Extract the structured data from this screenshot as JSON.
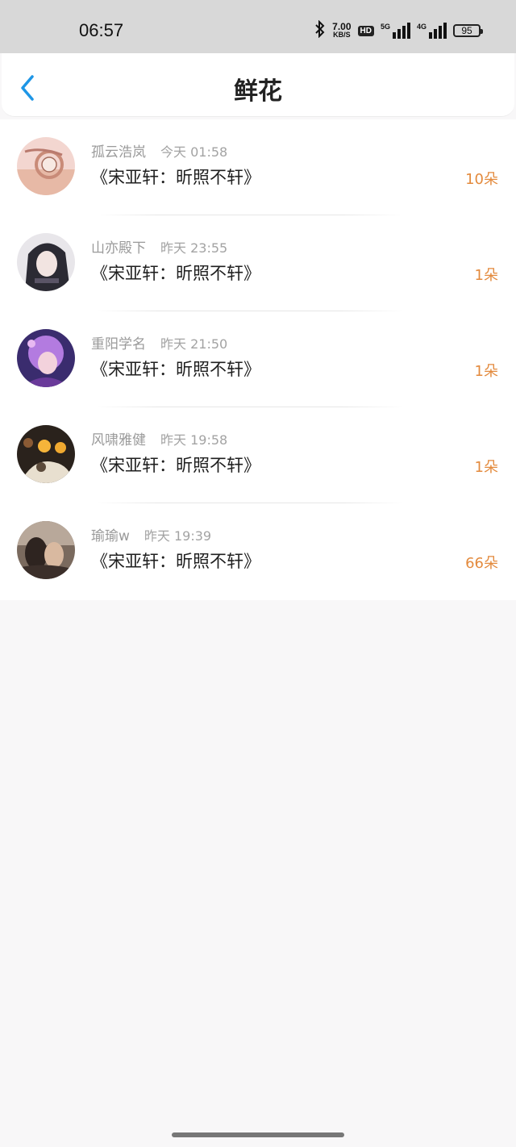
{
  "status_bar": {
    "time": "06:57",
    "net_speed_value": "7.00",
    "net_speed_unit": "KB/S",
    "hd_label": "HD",
    "signal_1_tag": "5G",
    "signal_2_tag": "4G",
    "battery": "95",
    "icons": [
      "bluetooth-icon",
      "signal-5g-icon",
      "signal-4g-icon",
      "battery-icon"
    ]
  },
  "nav": {
    "back_icon": "chevron-left-icon",
    "title": "鲜花"
  },
  "colors": {
    "accent": "#1e96e6",
    "count": "#e38a3d",
    "status_bar": "#d8d8d8"
  },
  "flowers": [
    {
      "name": "孤云浩岚",
      "time": "今天 01:58",
      "work": "《宋亚轩：昕照不轩》",
      "count": "10朵",
      "avatar": "avatar-pink-watch"
    },
    {
      "name": "山亦殿下",
      "time": "昨天 23:55",
      "work": "《宋亚轩：昕照不轩》",
      "count": "1朵",
      "avatar": "avatar-girl-dark-hair"
    },
    {
      "name": "重阳学名",
      "time": "昨天 21:50",
      "work": "《宋亚轩：昕照不轩》",
      "count": "1朵",
      "avatar": "avatar-anime-purple"
    },
    {
      "name": "风啸雅健",
      "time": "昨天 19:58",
      "work": "《宋亚轩：昕照不轩》",
      "count": "1朵",
      "avatar": "avatar-lights-cat"
    },
    {
      "name": "瑜瑜w",
      "time": "昨天 19:39",
      "work": "《宋亚轩：昕照不轩》",
      "count": "66朵",
      "avatar": "avatar-couple-photo"
    }
  ]
}
